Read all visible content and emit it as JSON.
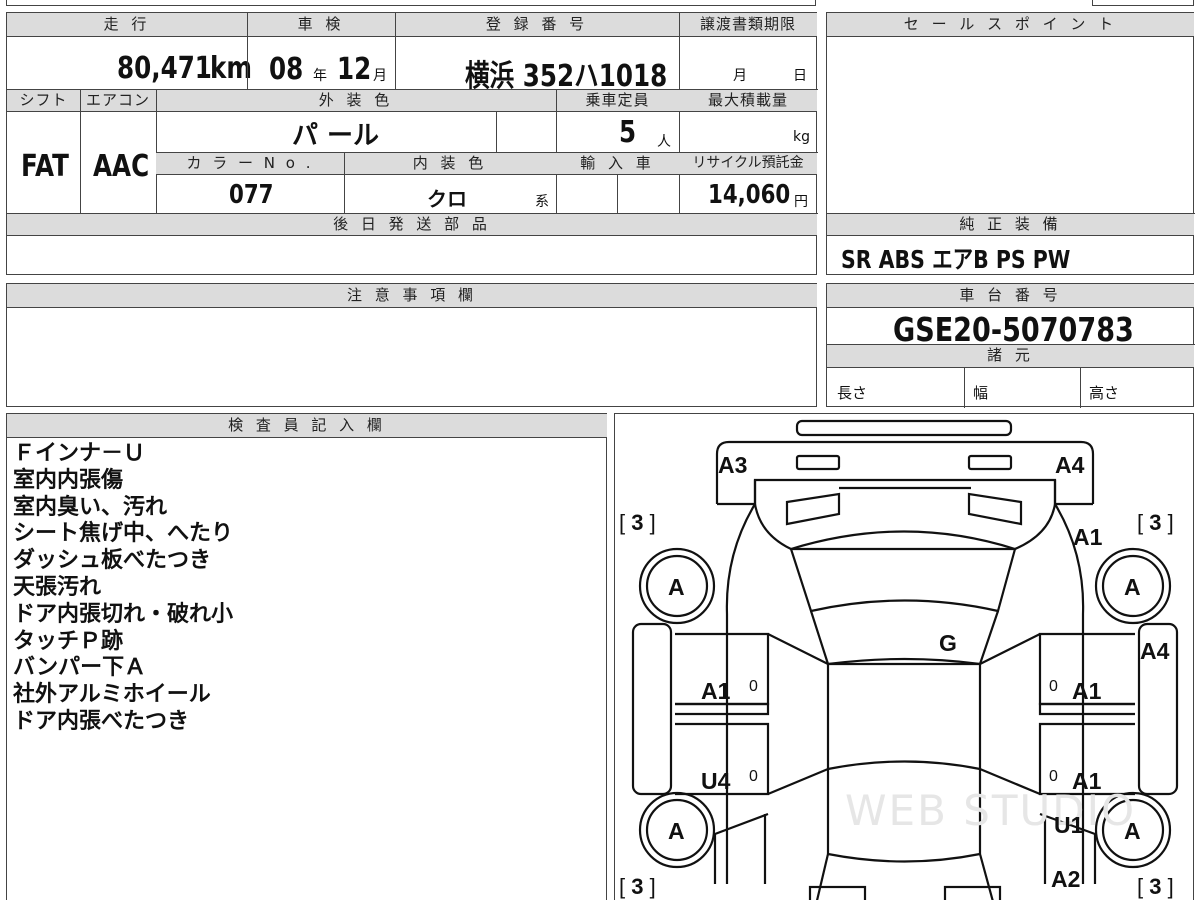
{
  "top_fragment": "",
  "vehicle": {
    "mileage_label": "走 行",
    "mileage_value": "80,471",
    "mileage_unit": "km",
    "inspection_label": "車 検",
    "inspection_year": "08",
    "inspection_year_unit": "年",
    "inspection_month": "12",
    "inspection_month_unit": "月",
    "registration_label": "登 録 番 号",
    "registration_value": "横浜 352ハ1018",
    "transfer_label": "譲渡書類期限",
    "transfer_month_unit": "月",
    "transfer_day_unit": "日",
    "shift_label": "シフト",
    "shift_value": "FAT",
    "aircon_label": "エアコン",
    "aircon_value": "AAC",
    "exterior_label": "外 装 色",
    "exterior_value": "パ ール",
    "capacity_label": "乗車定員",
    "capacity_value": "5",
    "capacity_unit": "人",
    "max_load_label": "最大積載量",
    "max_load_unit": "kg",
    "color_no_label": "カ ラ ー N o .",
    "color_no_value": "077",
    "interior_label": "内 装 色",
    "interior_value": "クロ",
    "interior_unit": "系",
    "import_label": "輸 入 車",
    "recycle_label": "リサイクル預託金",
    "recycle_value": "14,060",
    "recycle_unit": "円",
    "later_parts_label": "後 日 発 送 部 品"
  },
  "sales_point": {
    "label": "セ ー ル ス ポ イ ン ト"
  },
  "equipment": {
    "label": "純 正 装 備",
    "value": "SR ABS エアB PS PW"
  },
  "caution": {
    "label": "注 意 事 項 欄"
  },
  "chassis": {
    "label": "車 台 番 号",
    "value": "GSE20-5070783"
  },
  "specs": {
    "label": "諸 元",
    "length_label": "長さ",
    "width_label": "幅",
    "height_label": "高さ"
  },
  "inspector": {
    "label": "検 査 員 記 入 欄",
    "notes": [
      "Ｆインナ－Ｕ",
      "室内内張傷",
      "室内臭い、汚れ",
      "シート焦げ中、へたり",
      "ダッシュ板べたつき",
      "天張汚れ",
      "ドア内張切れ・破れ小",
      "タッチＰ跡",
      "バンパー下Ａ",
      "社外アルミホイール",
      "ドア内張べたつき"
    ]
  },
  "diagram": {
    "marks": {
      "front_left": "A3",
      "front_right": "A4",
      "fender_right": "A1",
      "windshield": "G",
      "quarter_right": "A4",
      "front_door_left": "A1",
      "front_door_right": "A1",
      "rear_door_left": "U4",
      "rear_door_right": "A1",
      "rear_quarter_right": "U1",
      "rear_bumper_right": "A2",
      "tire_fl": "A",
      "tire_fr": "A",
      "tire_rl": "A",
      "tire_rr": "A",
      "bracket_fl": "3",
      "bracket_fr": "3",
      "bracket_rl": "3",
      "bracket_rr": "3",
      "zero": "0"
    },
    "watermark": "WEB STUDIO"
  }
}
